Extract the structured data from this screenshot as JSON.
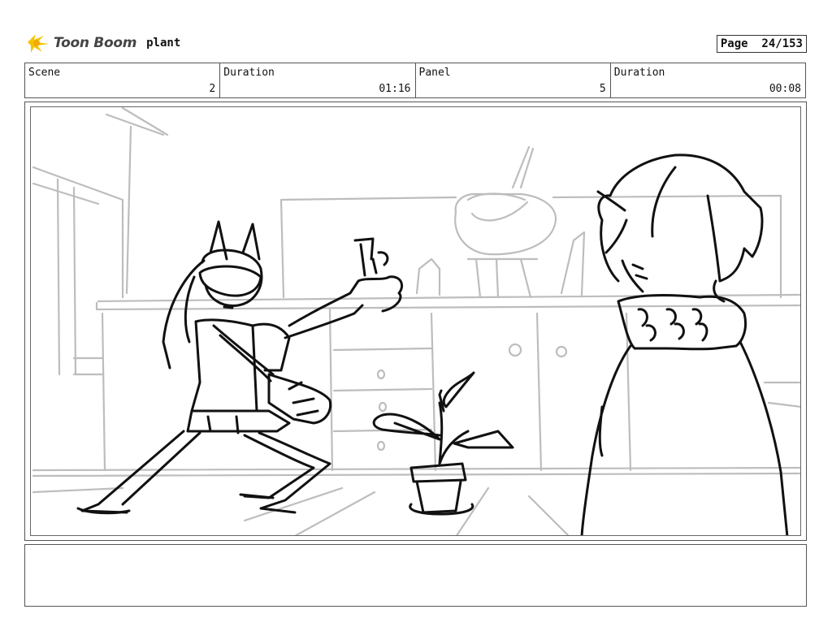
{
  "header": {
    "logo_text": "Toon Boom",
    "project_name": "plant",
    "page_label": "Page  24/153"
  },
  "info": {
    "scene_label": "Scene",
    "scene_value": "2",
    "scene_duration_label": "Duration",
    "scene_duration_value": "01:16",
    "panel_label": "Panel",
    "panel_value": "5",
    "panel_duration_label": "Duration",
    "panel_duration_value": "00:08"
  },
  "notes": {
    "text": ""
  },
  "colors": {
    "ink": "#111111",
    "background_ink": "#bdbdbd",
    "logo_yellow": "#f5c400"
  },
  "icons": [
    "toon-boom-logo-icon"
  ]
}
